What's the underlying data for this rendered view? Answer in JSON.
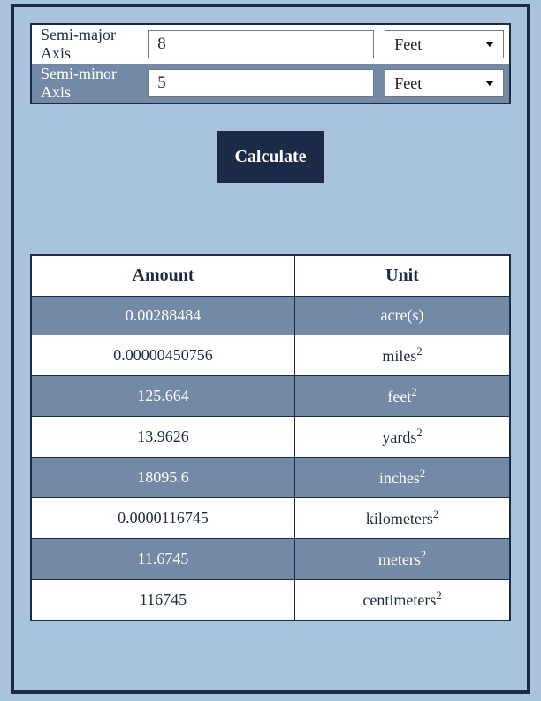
{
  "inputs": {
    "semi_major": {
      "label": "Semi-major Axis",
      "value": "8",
      "unit": "Feet"
    },
    "semi_minor": {
      "label": "Semi-minor Axis",
      "value": "5",
      "unit": "Feet"
    }
  },
  "calculate_label": "Calculate",
  "results": {
    "headers": {
      "amount": "Amount",
      "unit": "Unit"
    },
    "rows": [
      {
        "amount": "0.00288484",
        "unit": "acre(s)",
        "squared": false
      },
      {
        "amount": "0.00000450756",
        "unit": "miles",
        "squared": true
      },
      {
        "amount": "125.664",
        "unit": "feet",
        "squared": true
      },
      {
        "amount": "13.9626",
        "unit": "yards",
        "squared": true
      },
      {
        "amount": "18095.6",
        "unit": "inches",
        "squared": true
      },
      {
        "amount": "0.0000116745",
        "unit": "kilometers",
        "squared": true
      },
      {
        "amount": "11.6745",
        "unit": "meters",
        "squared": true
      },
      {
        "amount": "116745",
        "unit": "centimeters",
        "squared": true
      }
    ]
  }
}
